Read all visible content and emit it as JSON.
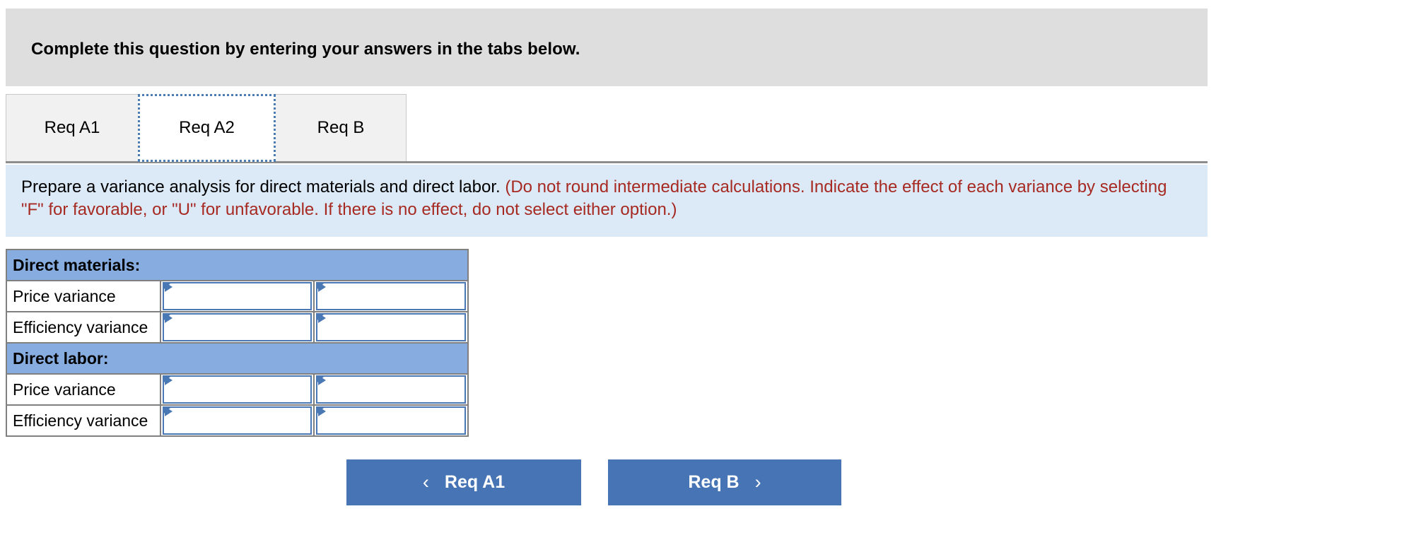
{
  "banner": {
    "text": "Complete this question by entering your answers in the tabs below."
  },
  "tabs": [
    {
      "label": "Req A1",
      "active": false
    },
    {
      "label": "Req A2",
      "active": true
    },
    {
      "label": "Req B",
      "active": false
    }
  ],
  "question": {
    "prompt": "Prepare a variance analysis for direct materials and direct labor.",
    "note": "(Do not round intermediate calculations. Indicate the effect of each variance by selecting \"F\" for favorable, or \"U\" for unfavorable. If there is no effect, do not select either option.)"
  },
  "table": {
    "rows": [
      {
        "type": "section",
        "label": "Direct materials:"
      },
      {
        "type": "input",
        "label": "Price variance",
        "amount": "",
        "effect": ""
      },
      {
        "type": "input",
        "label": "Efficiency variance",
        "amount": "",
        "effect": ""
      },
      {
        "type": "section",
        "label": "Direct labor:"
      },
      {
        "type": "input",
        "label": "Price variance",
        "amount": "",
        "effect": ""
      },
      {
        "type": "input",
        "label": "Efficiency variance",
        "amount": "",
        "effect": ""
      }
    ]
  },
  "nav": {
    "prev_label": "Req A1",
    "prev_icon": "chevron-left-icon",
    "prev_chevron": "‹",
    "next_label": "Req B",
    "next_icon": "chevron-right-icon",
    "next_chevron": "›"
  },
  "colors": {
    "banner_bg": "#dedede",
    "panel_bg": "#dce9f7",
    "note_text": "#a62a22",
    "section_bg": "#86ace0",
    "cell_border": "#4a78b4",
    "button_bg": "#4674b4",
    "tab_active_border": "#4b7db5"
  }
}
